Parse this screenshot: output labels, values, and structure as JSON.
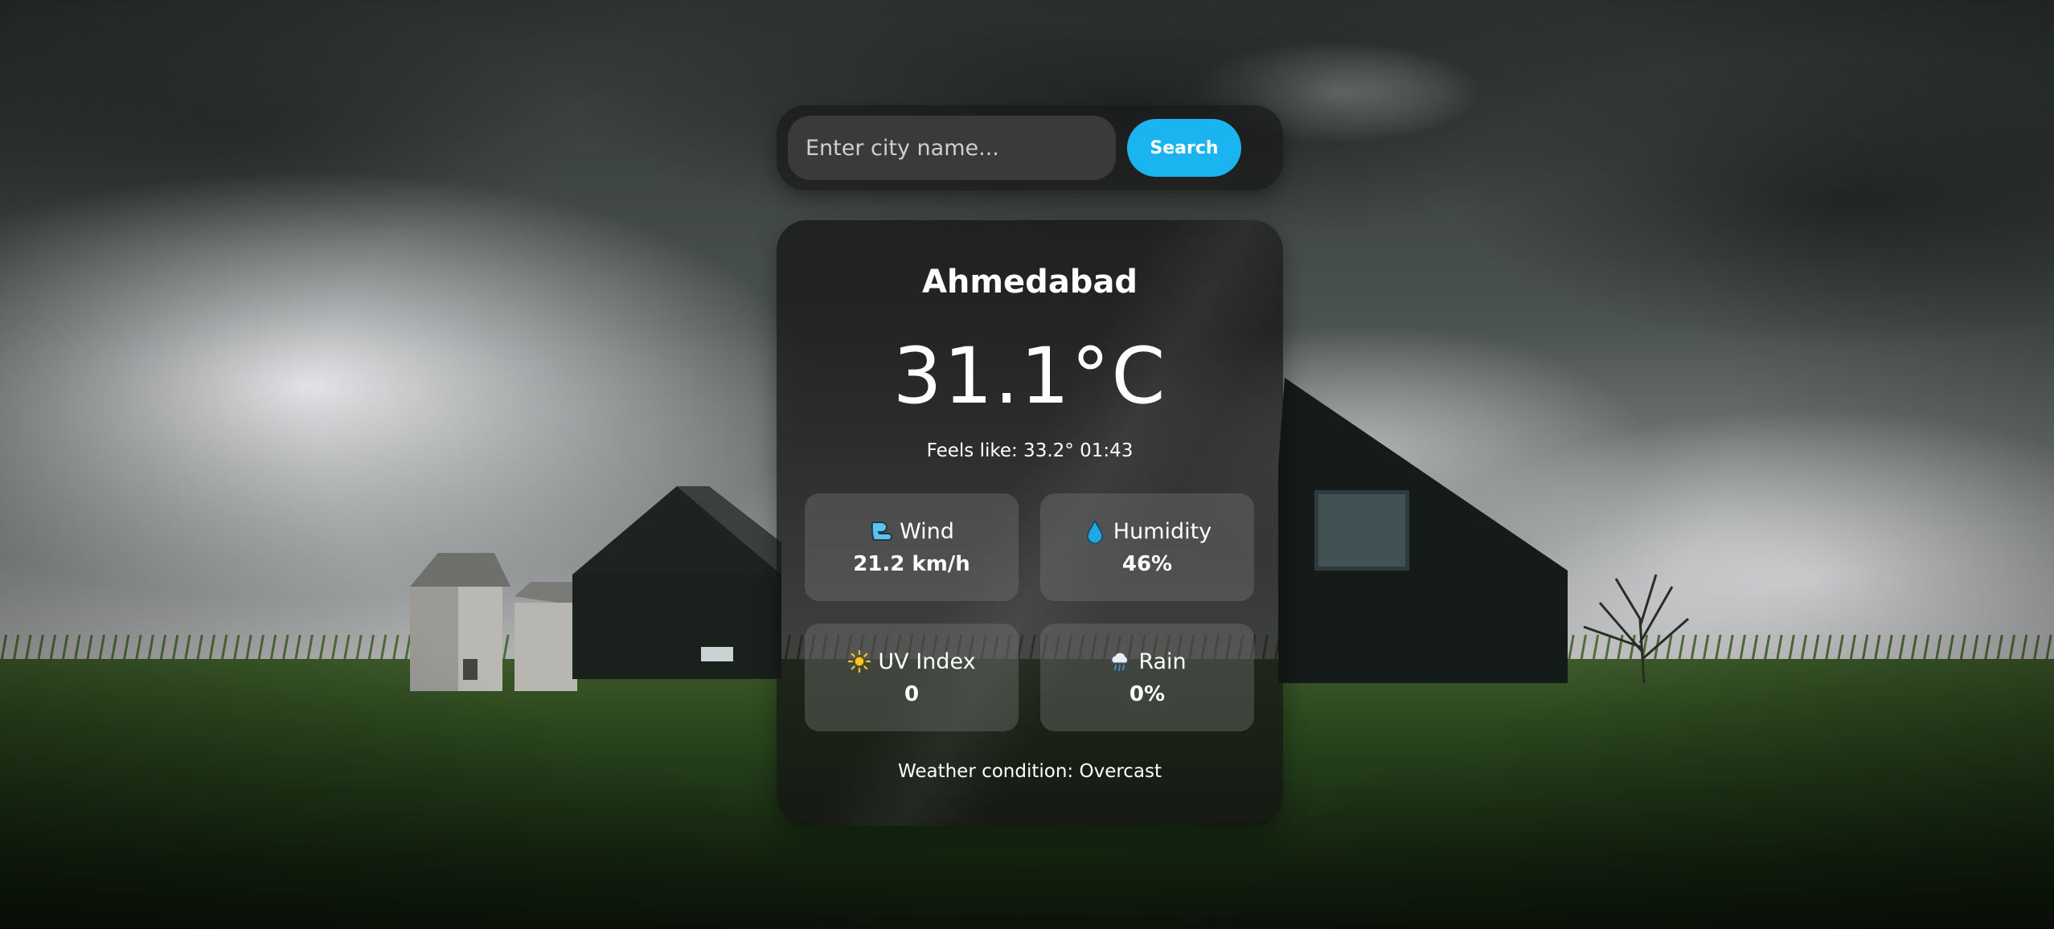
{
  "search": {
    "placeholder": "Enter city name...",
    "button_label": "Search"
  },
  "weather": {
    "city": "Ahmedabad",
    "temperature": "31.1°C",
    "feels_like": "Feels like: 33.2° 01:43",
    "stats": {
      "wind": {
        "label": "Wind",
        "value": "21.2 km/h",
        "icon": "wind-icon"
      },
      "humidity": {
        "label": "Humidity",
        "value": "46%",
        "icon": "droplet-icon"
      },
      "uv": {
        "label": "UV Index",
        "value": "0",
        "icon": "sun-icon"
      },
      "rain": {
        "label": "Rain",
        "value": "0%",
        "icon": "rain-cloud-icon"
      }
    },
    "condition": "Weather condition: Overcast"
  },
  "colors": {
    "accent": "#1ab5f0",
    "card_bg": "rgba(20,20,20,0.72)",
    "tile_bg": "rgba(120,120,120,0.38)"
  }
}
